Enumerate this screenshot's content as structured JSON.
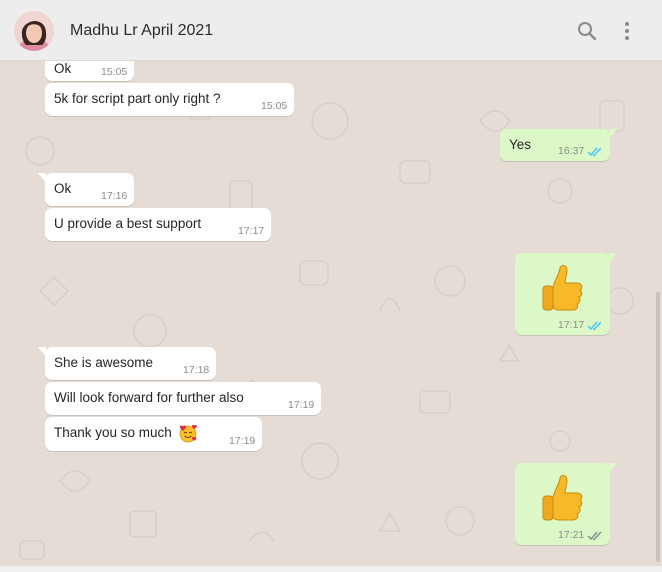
{
  "contact": {
    "name": "Madhu Lr April 2021",
    "avatar_icon": "profile-photo"
  },
  "header_icons": [
    "search-icon",
    "menu-dots-icon"
  ],
  "colors": {
    "header_bg": "#ededed",
    "chat_bg": "#e5ddd5",
    "incoming_bg": "#ffffff",
    "outgoing_bg": "#dcf8c6",
    "read_tick": "#4fc3f7",
    "sent_tick": "#8c8c8c"
  },
  "messages": [
    {
      "direction": "incoming",
      "text": "Ok",
      "time": "15:05"
    },
    {
      "direction": "incoming",
      "text": "5k for script part only right ?",
      "time": "15:05"
    },
    {
      "direction": "outgoing",
      "text": "Yes",
      "time": "16:37",
      "status": "read"
    },
    {
      "direction": "incoming",
      "text": "Ok",
      "time": "17:16"
    },
    {
      "direction": "incoming",
      "text": "U provide a best support",
      "time": "17:17"
    },
    {
      "direction": "outgoing",
      "text": "",
      "emoji": "thumbs-up",
      "time": "17:17",
      "status": "read"
    },
    {
      "direction": "incoming",
      "text": "She is awesome",
      "time": "17:18"
    },
    {
      "direction": "incoming",
      "text": "Will look forward for further also",
      "time": "17:19"
    },
    {
      "direction": "incoming",
      "text": "Thank you so much",
      "emoji": "smiling-face-with-hearts",
      "time": "17:19"
    },
    {
      "direction": "outgoing",
      "text": "",
      "emoji": "thumbs-up",
      "time": "17:21",
      "status": "delivered"
    }
  ]
}
